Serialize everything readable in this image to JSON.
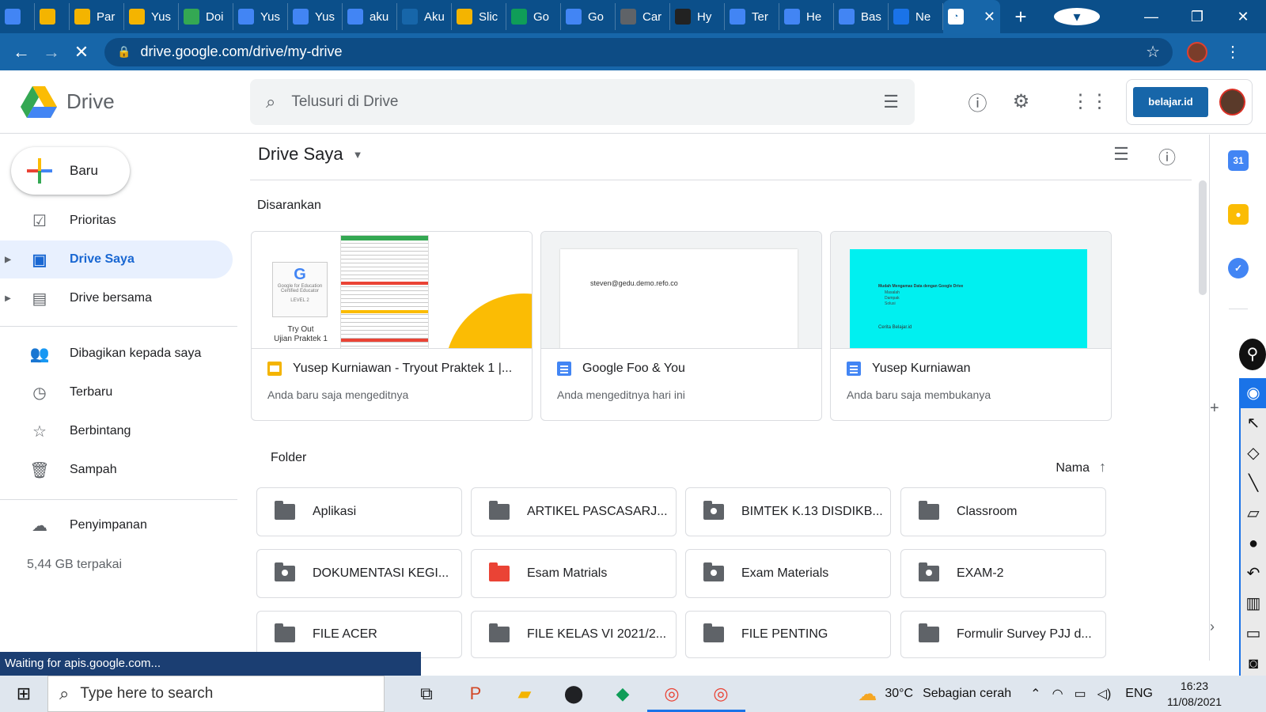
{
  "browser": {
    "tabs": [
      {
        "label": "",
        "color": "#4285f4"
      },
      {
        "label": "",
        "color": "#f4b400"
      },
      {
        "label": "Par",
        "color": "#f4b400"
      },
      {
        "label": "Yus",
        "color": "#f4b400"
      },
      {
        "label": "Doi",
        "color": "#34a853"
      },
      {
        "label": "Yus",
        "color": "#4285f4"
      },
      {
        "label": "Yus",
        "color": "#4285f4"
      },
      {
        "label": "aku",
        "color": "#4285f4"
      },
      {
        "label": "Aku",
        "color": "#1766a9"
      },
      {
        "label": "Slic",
        "color": "#f4b400"
      },
      {
        "label": "Go",
        "color": "#0f9d58"
      },
      {
        "label": "Go",
        "color": "#4285f4"
      },
      {
        "label": "Car",
        "color": "#5f6368"
      },
      {
        "label": "Hy",
        "color": "#222222"
      },
      {
        "label": "Ter",
        "color": "#4285f4"
      },
      {
        "label": "He",
        "color": "#4285f4"
      },
      {
        "label": "Bas",
        "color": "#4285f4"
      },
      {
        "label": "Ne",
        "color": "#1a73e8"
      }
    ],
    "active_tab_close": "✕",
    "new_tab": "+",
    "url": "drive.google.com/drive/my-drive"
  },
  "header": {
    "app_name": "Drive",
    "search_placeholder": "Telusuri di Drive",
    "account_badge": "belajar.id"
  },
  "sidebar": {
    "new_button": "Baru",
    "items": [
      {
        "label": "Prioritas",
        "icon": "priority-icon"
      },
      {
        "label": "Drive Saya",
        "icon": "my-drive-icon"
      },
      {
        "label": "Drive bersama",
        "icon": "shared-drives-icon"
      },
      {
        "label": "Dibagikan kepada saya",
        "icon": "shared-with-me-icon"
      },
      {
        "label": "Terbaru",
        "icon": "recent-icon"
      },
      {
        "label": "Berbintang",
        "icon": "starred-icon"
      },
      {
        "label": "Sampah",
        "icon": "trash-icon"
      },
      {
        "label": "Penyimpanan",
        "icon": "storage-icon"
      }
    ],
    "storage_used": "5,44 GB terpakai"
  },
  "main": {
    "title": "Drive Saya",
    "suggested_label": "Disarankan",
    "suggested": [
      {
        "name": "Yusep Kurniawan - Tryout Praktek 1 |...",
        "sub": "Anda baru saja mengeditnya",
        "type": "slides",
        "thumb_caption1": "Try Out",
        "thumb_caption2": "Ujian Praktek 1",
        "thumb_badge_line1": "Google for Education",
        "thumb_badge_line2": "Certified Educator",
        "thumb_badge_line3": "LEVEL 2"
      },
      {
        "name": "Google Foo & You",
        "sub": "Anda mengeditnya hari ini",
        "type": "docs",
        "thumb_text": "steven@gedu.demo.refo.co"
      },
      {
        "name": "Yusep Kurniawan",
        "sub": "Anda baru saja membukanya",
        "type": "docs",
        "thumb_title": "Mudah Mengamas Data dengan Google Drive",
        "thumb_rows": [
          "Masalah",
          "Dampak",
          "Solusi"
        ],
        "thumb_footer": "Cerita Belajar.id"
      }
    ],
    "folder_label": "Folder",
    "sort_label": "Nama",
    "folders": [
      {
        "name": "Aplikasi",
        "kind": "plain"
      },
      {
        "name": "ARTIKEL PASCASARJ...",
        "kind": "plain"
      },
      {
        "name": "BIMTEK K.13 DISDIKB...",
        "kind": "shared"
      },
      {
        "name": "Classroom",
        "kind": "plain"
      },
      {
        "name": "DOKUMENTASI KEGI...",
        "kind": "shared"
      },
      {
        "name": "Esam Matrials",
        "kind": "red"
      },
      {
        "name": "Exam Materials",
        "kind": "shared"
      },
      {
        "name": "EXAM-2",
        "kind": "shared"
      },
      {
        "name": "FILE ACER",
        "kind": "plain"
      },
      {
        "name": "FILE KELAS VI 2021/2...",
        "kind": "plain"
      },
      {
        "name": "FILE PENTING",
        "kind": "plain"
      },
      {
        "name": "Formulir Survey PJJ d...",
        "kind": "plain"
      }
    ]
  },
  "statusbar": "Waiting for apis.google.com...",
  "taskbar": {
    "search_placeholder": "Type here to search",
    "weather_temp": "30°C",
    "weather_desc": "Sebagian cerah",
    "lang": "ENG",
    "time": "16:23",
    "date": "11/08/2021"
  }
}
